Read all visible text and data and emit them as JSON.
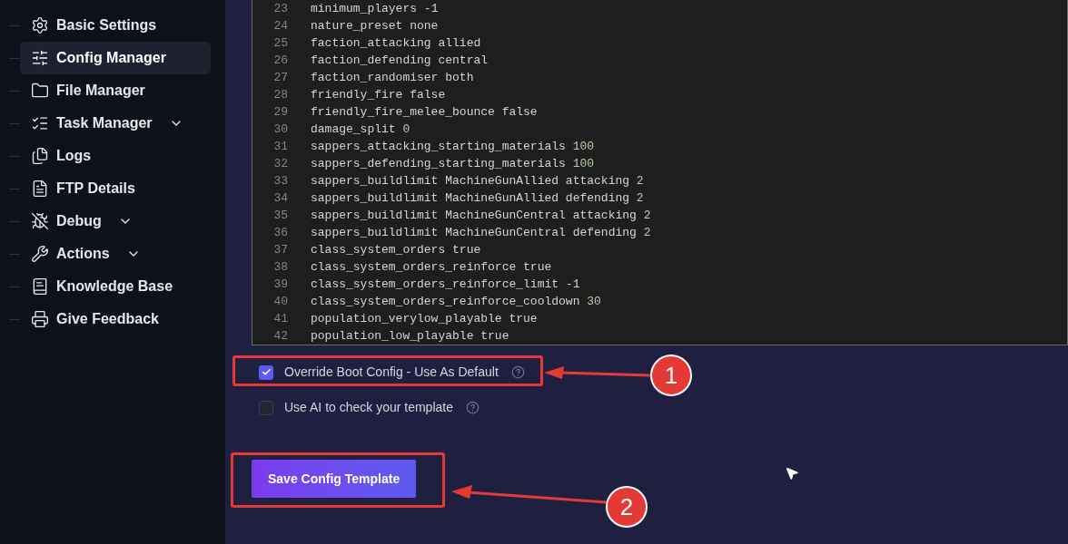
{
  "sidebar": {
    "items": [
      {
        "label": "Basic Settings",
        "selected": false,
        "has_submenu": false
      },
      {
        "label": "Config Manager",
        "selected": true,
        "has_submenu": false
      },
      {
        "label": "File Manager",
        "selected": false,
        "has_submenu": false
      },
      {
        "label": "Task Manager",
        "selected": false,
        "has_submenu": true
      },
      {
        "label": "Logs",
        "selected": false,
        "has_submenu": false
      },
      {
        "label": "FTP Details",
        "selected": false,
        "has_submenu": false
      },
      {
        "label": "Debug",
        "selected": false,
        "has_submenu": true
      },
      {
        "label": "Actions",
        "selected": false,
        "has_submenu": true
      },
      {
        "label": "Knowledge Base",
        "selected": false,
        "has_submenu": false
      },
      {
        "label": "Give Feedback",
        "selected": false,
        "has_submenu": false
      }
    ]
  },
  "editor": {
    "lines": [
      {
        "number": "23",
        "key": "minimum_players",
        "value": "-1",
        "kind": "text"
      },
      {
        "number": "24",
        "key": "nature_preset",
        "value": "none",
        "kind": "text"
      },
      {
        "number": "25",
        "key": "faction_attacking",
        "value": "allied",
        "kind": "text"
      },
      {
        "number": "26",
        "key": "faction_defending",
        "value": "central",
        "kind": "text"
      },
      {
        "number": "27",
        "key": "faction_randomiser",
        "value": "both",
        "kind": "text"
      },
      {
        "number": "28",
        "key": "friendly_fire",
        "value": "false",
        "kind": "text"
      },
      {
        "number": "29",
        "key": "friendly_fire_melee_bounce",
        "value": "false",
        "kind": "text"
      },
      {
        "number": "30",
        "key": "damage_split",
        "value": "0",
        "kind": "number"
      },
      {
        "number": "31",
        "key": "sappers_attacking_starting_materials",
        "value": "100",
        "kind": "number"
      },
      {
        "number": "32",
        "key": "sappers_defending_starting_materials",
        "value": "100",
        "kind": "number"
      },
      {
        "number": "33",
        "key": "sappers_buildlimit MachineGunAllied attacking",
        "value": "2",
        "kind": "number"
      },
      {
        "number": "34",
        "key": "sappers_buildlimit MachineGunAllied defending",
        "value": "2",
        "kind": "number"
      },
      {
        "number": "35",
        "key": "sappers_buildlimit MachineGunCentral attacking",
        "value": "2",
        "kind": "number"
      },
      {
        "number": "36",
        "key": "sappers_buildlimit MachineGunCentral defending",
        "value": "2",
        "kind": "number"
      },
      {
        "number": "37",
        "key": "class_system_orders",
        "value": "true",
        "kind": "text"
      },
      {
        "number": "38",
        "key": "class_system_orders_reinforce",
        "value": "true",
        "kind": "text"
      },
      {
        "number": "39",
        "key": "class_system_orders_reinforce_limit",
        "value": "-1",
        "kind": "text"
      },
      {
        "number": "40",
        "key": "class_system_orders_reinforce_cooldown",
        "value": "30",
        "kind": "number"
      },
      {
        "number": "41",
        "key": "population_verylow_playable",
        "value": "true",
        "kind": "text"
      },
      {
        "number": "42",
        "key": "population_low_playable",
        "value": "true",
        "kind": "text"
      }
    ]
  },
  "options": [
    {
      "label": "Override Boot Config - Use As Default",
      "checked": true
    },
    {
      "label": "Use AI to check your template",
      "checked": false
    }
  ],
  "save_button": "Save Config Template",
  "annotations": [
    {
      "label": "1"
    },
    {
      "label": "2"
    }
  ]
}
